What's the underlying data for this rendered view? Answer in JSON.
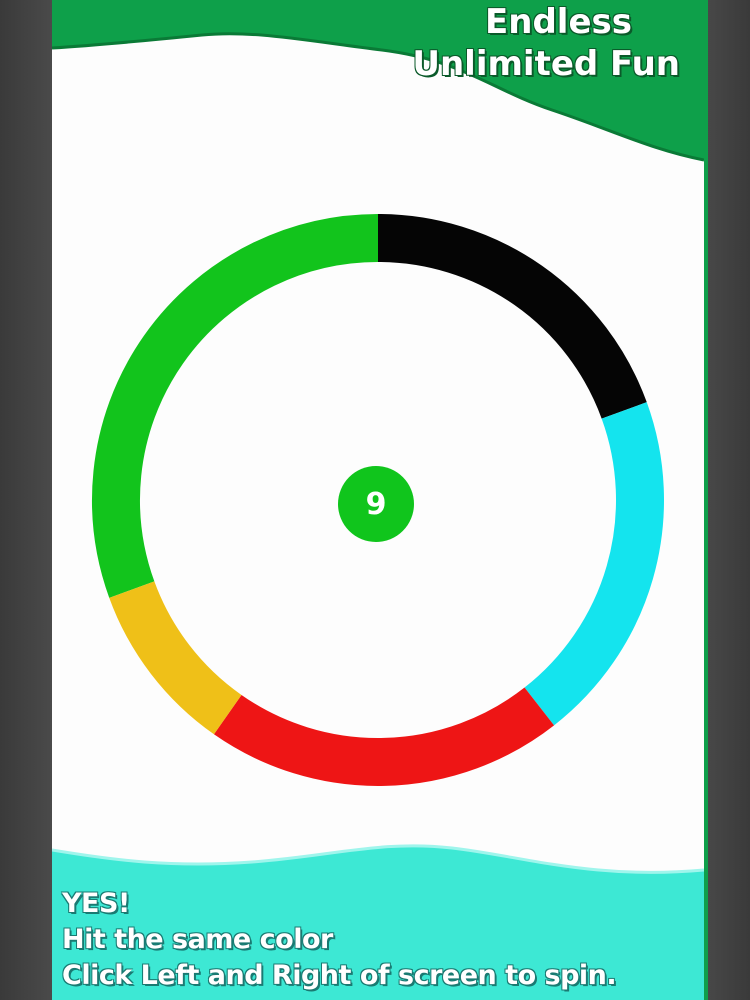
{
  "banner": {
    "line1": "Endless",
    "line2": "Unlimited Fun"
  },
  "game": {
    "score": "9",
    "ball_color": "#10c51c",
    "ring_segments": [
      {
        "color_name": "green",
        "color": "#12c41c"
      },
      {
        "color_name": "black",
        "color": "#050505"
      },
      {
        "color_name": "cyan",
        "color": "#14e4ee"
      },
      {
        "color_name": "red",
        "color": "#ee1515"
      },
      {
        "color_name": "yellow",
        "color": "#efc018"
      }
    ]
  },
  "instructions": {
    "line1": "YES!",
    "line2": "Hit the same color",
    "line3": "Click Left and Right of screen to spin."
  },
  "colors": {
    "top_banner": "#0ea04a",
    "bottom_banner": "#3de8d4"
  }
}
